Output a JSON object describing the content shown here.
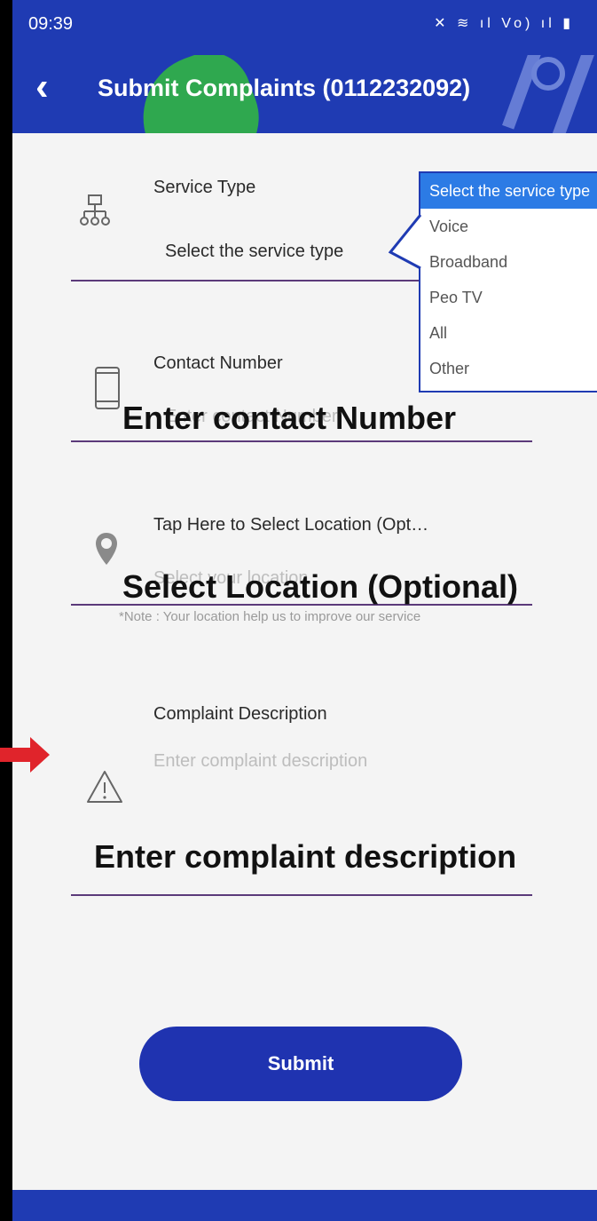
{
  "status_bar": {
    "time": "09:39",
    "icons": "✕ ≋ ıl Vo) ıl ▮"
  },
  "header": {
    "title": "Submit Complaints (0112232092)"
  },
  "service_type": {
    "label": "Service Type",
    "value": "Select the service type"
  },
  "dropdown": {
    "options": [
      "Select the service type",
      "Voice",
      "Broadband",
      "Peo TV",
      "All",
      "Other"
    ]
  },
  "contact": {
    "label": "Contact Number",
    "placeholder": "Enter contact Number",
    "overlay": "Enter contact Number"
  },
  "location": {
    "label": "Tap Here to Select Location (Opt…",
    "placeholder": "Select your location",
    "note": "*Note : Your location help us to improve our service",
    "overlay": "Select Location (Optional)"
  },
  "complaint": {
    "label": "Complaint Description",
    "placeholder": "Enter complaint description",
    "overlay": "Enter complaint description"
  },
  "submit": {
    "label": "Submit"
  },
  "colors": {
    "primary": "#1f3bb3",
    "accent": "#2fa84f",
    "selected": "#2c7be5",
    "annotation": "#e0242b"
  }
}
